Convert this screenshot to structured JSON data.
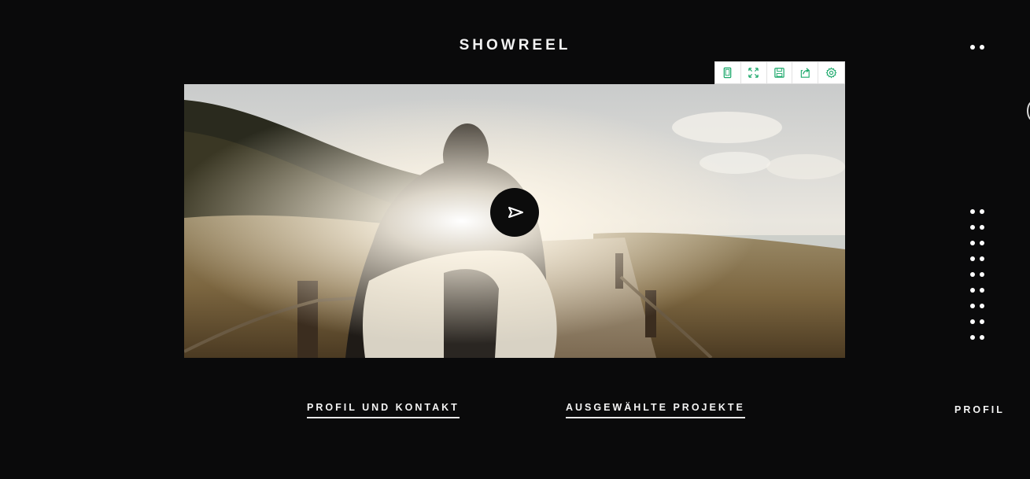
{
  "header": {
    "title": "SHOWREEL"
  },
  "toolbar": {
    "accent_color": "#1aa86a",
    "tools": [
      {
        "icon": "mobile-frame-icon"
      },
      {
        "icon": "expand-arrows-icon"
      },
      {
        "icon": "save-disk-icon"
      },
      {
        "icon": "share-arrow-icon"
      },
      {
        "icon": "gear-icon"
      }
    ]
  },
  "video": {
    "play_icon": "play-icon",
    "scene": "surfer-walking-on-beach-path-at-sunset"
  },
  "nav": {
    "profil_kontakt": "PROFIL UND KONTAKT",
    "projekte": "AUSGEWÄHLTE PROJEKTE",
    "side_label": "PROFIL"
  }
}
